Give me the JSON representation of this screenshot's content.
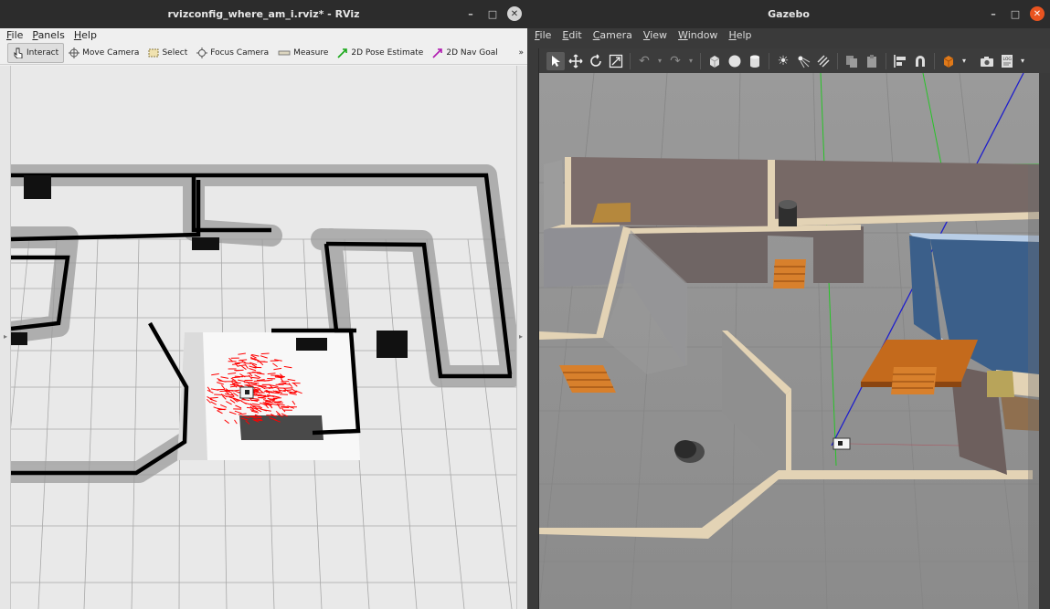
{
  "rviz": {
    "title": "rvizconfig_where_am_i.rviz* - RViz",
    "menu": [
      "File",
      "Panels",
      "Help"
    ],
    "toolbar": [
      {
        "label": "Interact",
        "icon": "cursor-hand-icon",
        "active": true
      },
      {
        "label": "Move Camera",
        "icon": "move-camera-icon",
        "active": false
      },
      {
        "label": "Select",
        "icon": "select-icon",
        "active": false
      },
      {
        "label": "Focus Camera",
        "icon": "focus-camera-icon",
        "active": false
      },
      {
        "label": "Measure",
        "icon": "measure-icon",
        "active": false
      },
      {
        "label": "2D Pose Estimate",
        "icon": "pose-estimate-arrow-icon",
        "active": false,
        "color": "#1aa81a"
      },
      {
        "label": "2D Nav Goal",
        "icon": "nav-goal-arrow-icon",
        "active": false,
        "color": "#b01ab0"
      }
    ],
    "toolbar_more": "»",
    "colors": {
      "map_free": "#ffffff",
      "map_wall": "#000000",
      "inflation": "#8f8f8f",
      "particles": "#ff0000",
      "grid": "#a0a0a0"
    }
  },
  "gazebo": {
    "title": "Gazebo",
    "menu": [
      "File",
      "Edit",
      "Camera",
      "View",
      "Window",
      "Help"
    ],
    "toolbar_icons": [
      "select-arrow-icon",
      "translate-icon",
      "rotate-icon",
      "scale-icon",
      "undo-icon",
      "undo-dropdown-icon",
      "redo-icon",
      "redo-dropdown-icon",
      "box-shape-icon",
      "sphere-shape-icon",
      "cylinder-shape-icon",
      "point-light-icon",
      "spot-light-icon",
      "directional-light-icon",
      "copy-icon",
      "paste-icon",
      "align-icon",
      "snap-magnet-icon",
      "orange-cube-view-icon",
      "screenshot-camera-icon",
      "log-record-icon"
    ],
    "colors": {
      "ground": "#8c8c8c",
      "wall_tan": "#e3d3b5",
      "wall_gray": "#8f8f94",
      "wall_blue": "#3b5f8a",
      "wall_brown": "#7b6c6a",
      "shelf": "#c46a1c",
      "laser_line": "#1e1ecc"
    }
  },
  "window_controls": {
    "minimize": "–",
    "maximize": "□",
    "close": "✕"
  }
}
